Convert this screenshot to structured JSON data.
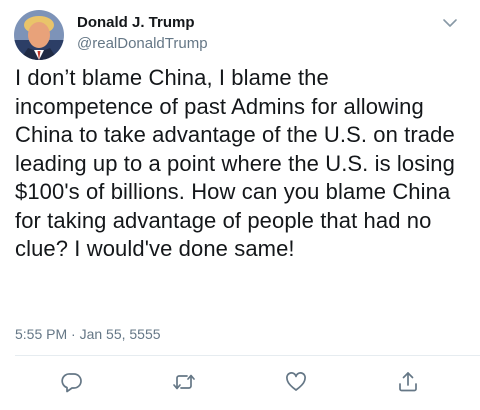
{
  "author": {
    "display_name": "Donald J. Trump",
    "handle": "@realDonaldTrump",
    "avatar_icon": "profile-photo"
  },
  "tweet": {
    "text": "I don’t blame China, I blame the incompetence of past Admins for allowing China to take advantage of the U.S. on trade leading up to a point where the U.S. is losing $100's of billions. How can you blame China for taking advantage of people that had no clue? I would've done same!",
    "timestamp": "5:55 PM · Jan 55, 5555"
  },
  "actions": {
    "reply_icon": "reply-icon",
    "retweet_icon": "retweet-icon",
    "like_icon": "heart-icon",
    "share_icon": "share-icon"
  },
  "colors": {
    "text": "#14171a",
    "secondary": "#657786",
    "divider": "#e6ecf0",
    "icon": "#657786"
  }
}
